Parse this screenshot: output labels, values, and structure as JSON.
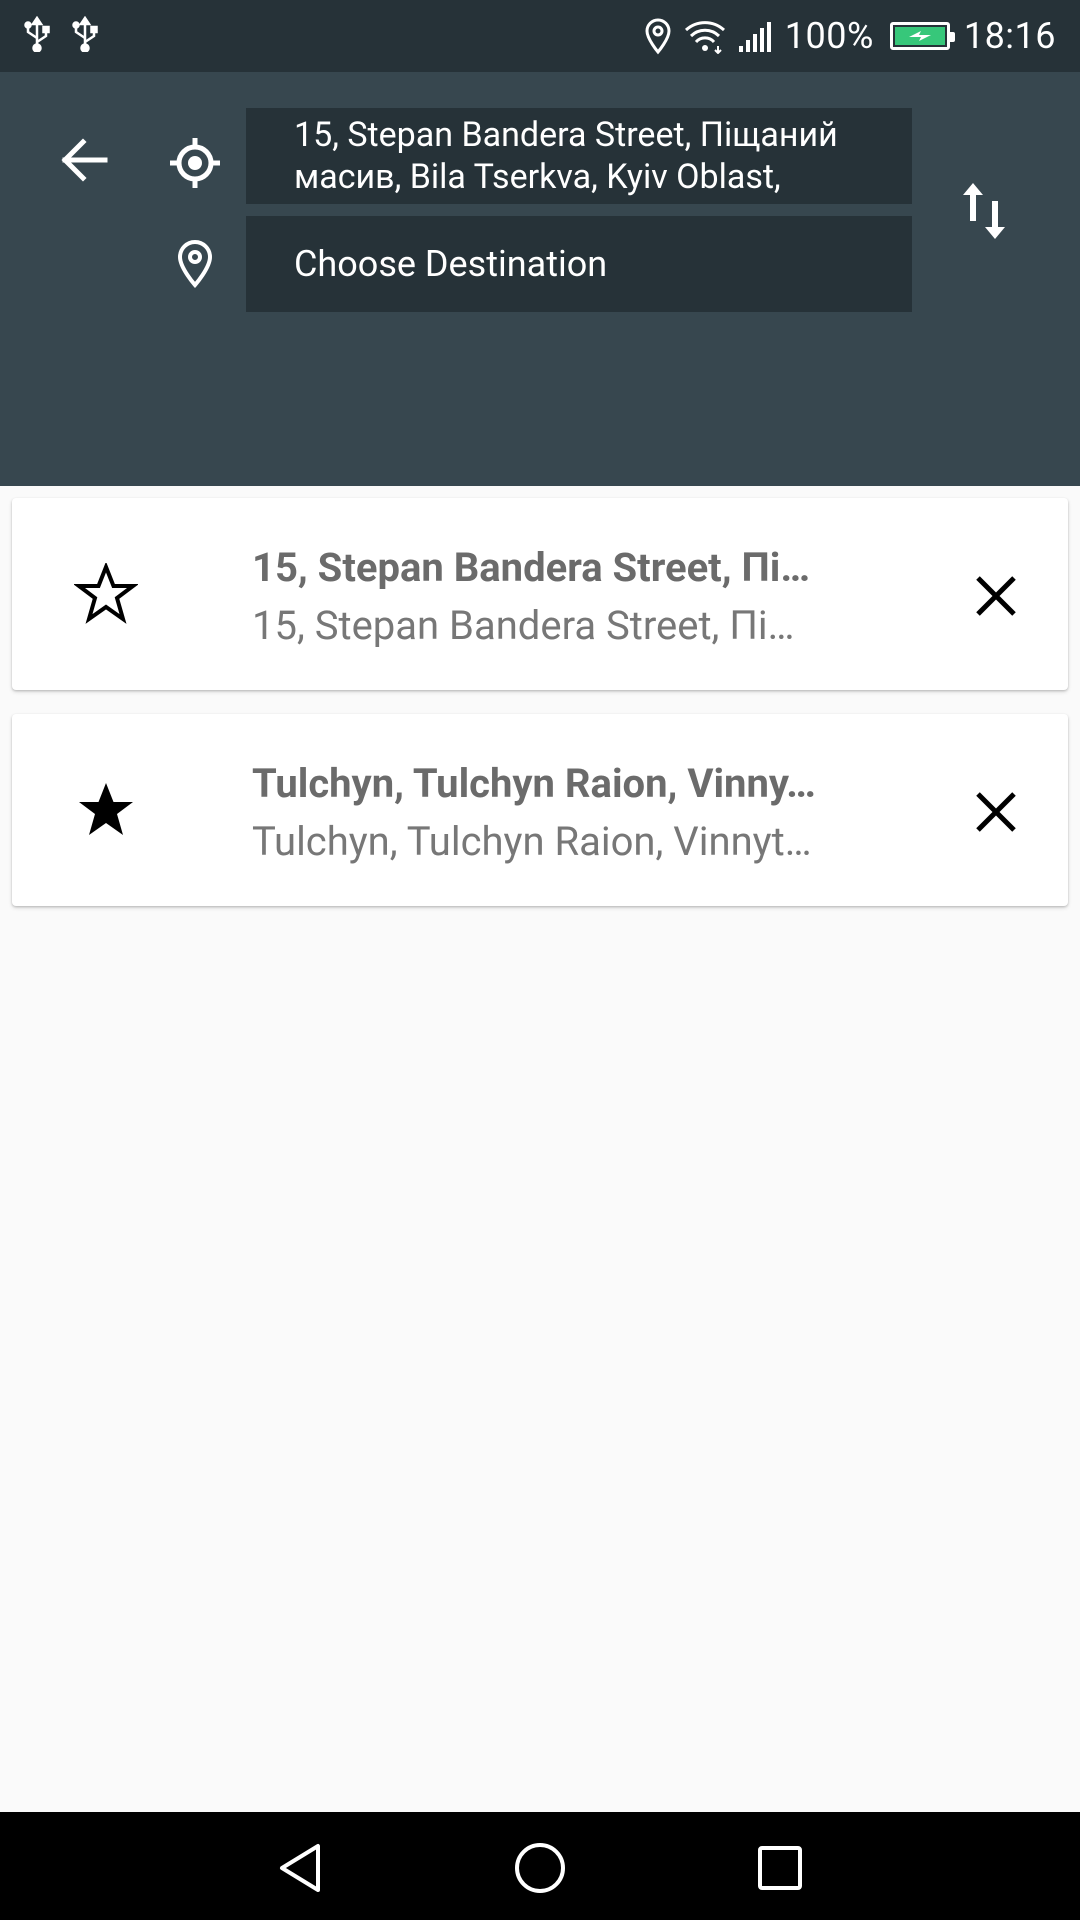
{
  "status_bar": {
    "battery_percent": "100%",
    "time": "18:16",
    "icons": [
      "usb-icon",
      "usb-icon",
      "location-icon",
      "wifi-icon",
      "signal-icon",
      "battery-icon"
    ]
  },
  "route": {
    "origin": "15, Stepan Bandera Street, Піщаний масив, Bila Tserkva, Kyiv Oblast,",
    "destination_placeholder": "Choose Destination"
  },
  "history": [
    {
      "favorite": false,
      "title": "15, Stepan Bandera Street, Пі…",
      "subtitle": "15, Stepan Bandera Street, Пі…"
    },
    {
      "favorite": true,
      "title": "Tulchyn, Tulchyn Raion, Vinny…",
      "subtitle": "Tulchyn, Tulchyn Raion, Vinnyt…"
    }
  ],
  "colors": {
    "status_bar": "#263238",
    "panel": "#37474f",
    "field": "#263238",
    "background": "#fafafa",
    "battery_fill": "#37c77a"
  }
}
